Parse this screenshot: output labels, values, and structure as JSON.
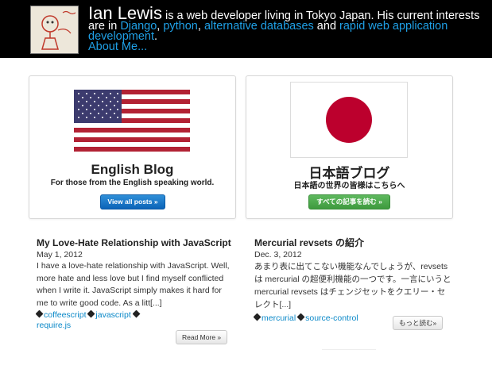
{
  "header": {
    "name": "Ian Lewis",
    "text_1": " is a web developer living in Tokyo Japan. His current interests are in ",
    "link_django": "Django",
    "text_2": ", ",
    "link_python": "python",
    "text_3": ", ",
    "link_altdb": "alternative databases",
    "text_4": " and ",
    "link_rapid": "rapid web application development",
    "text_5": ".",
    "about_link": "About Me..."
  },
  "cards": {
    "english": {
      "title": "English Blog",
      "subtitle": "For those from the English speaking world.",
      "button": "View all posts »"
    },
    "japanese": {
      "title": "日本語ブログ",
      "subtitle": "日本語の世界の皆様はこちらへ",
      "button": "すべての記事を読む »"
    }
  },
  "posts": {
    "english": {
      "title": "My Love-Hate Relationship with JavaScript",
      "date": "May 1, 2012",
      "body": "I have a love-hate relationship with JavaScript. Well, more hate and less love but I find myself conflicted when I write it. JavaScript simply makes it hard for me to write good code. As a litt[...]",
      "tags": [
        "coffeescript",
        "javascript",
        "require.js"
      ],
      "read_more": "Read More »"
    },
    "japanese": {
      "title": "Mercurial revsets の紹介",
      "date": "Dec. 3, 2012",
      "body": "あまり表に出てこない機能なんでしょうが、revsetsは mercurial の超便利機能の一つです。一言にいうと mercurial revsets はチェンジセットをクエリー・セレクト[...]",
      "tags": [
        "mercurial",
        "source-control"
      ],
      "read_more": "もっと読む»"
    }
  },
  "colors": {
    "header_bg": "#000000",
    "link": "#1fa0e6",
    "blue_button": "#0b63b8",
    "green_button": "#3e9a3e",
    "flag_red": "#b22234",
    "flag_blue": "#3c3b6e",
    "japan_red": "#bc002d"
  }
}
